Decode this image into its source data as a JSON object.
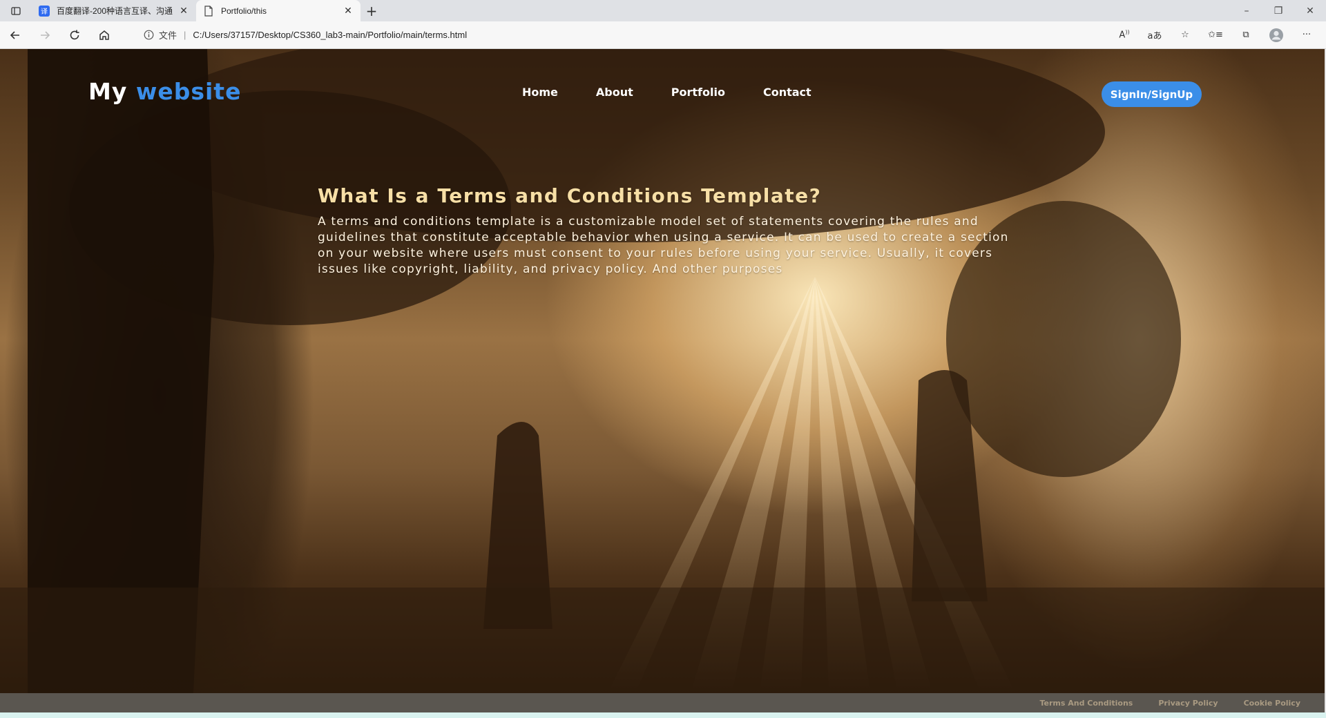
{
  "browser": {
    "tabs": [
      {
        "title": "百度翻译-200种语言互译、沟通",
        "active": false,
        "favicon": "baidu-translate-icon"
      },
      {
        "title": "Portfolio/this",
        "active": true,
        "favicon": "page-icon"
      }
    ],
    "address_scheme": "文件",
    "url": "C:/Users/37157/Desktop/CS360_lab3-main/Portfolio/main/terms.html"
  },
  "site": {
    "logo_first": "My",
    "logo_second": "website",
    "accent_color": "#3b8ee8",
    "nav": [
      {
        "label": "Home"
      },
      {
        "label": "About"
      },
      {
        "label": "Portfolio"
      },
      {
        "label": "Contact"
      }
    ],
    "signin_label": "SignIn/SignUp"
  },
  "main": {
    "heading": "What Is a Terms and Conditions Template?",
    "body": "A terms and conditions template is a customizable model set of statements covering the rules and guidelines that constitute acceptable behavior when using a service. It can be used to create a section on your website where users must consent to your rules before using your service. Usually, it covers issues like copyright, liability, and privacy policy. And other purposes"
  },
  "footer": {
    "links": [
      {
        "label": "Terms And Conditions"
      },
      {
        "label": "Privacy Policy"
      },
      {
        "label": "Cookie Policy"
      }
    ]
  }
}
